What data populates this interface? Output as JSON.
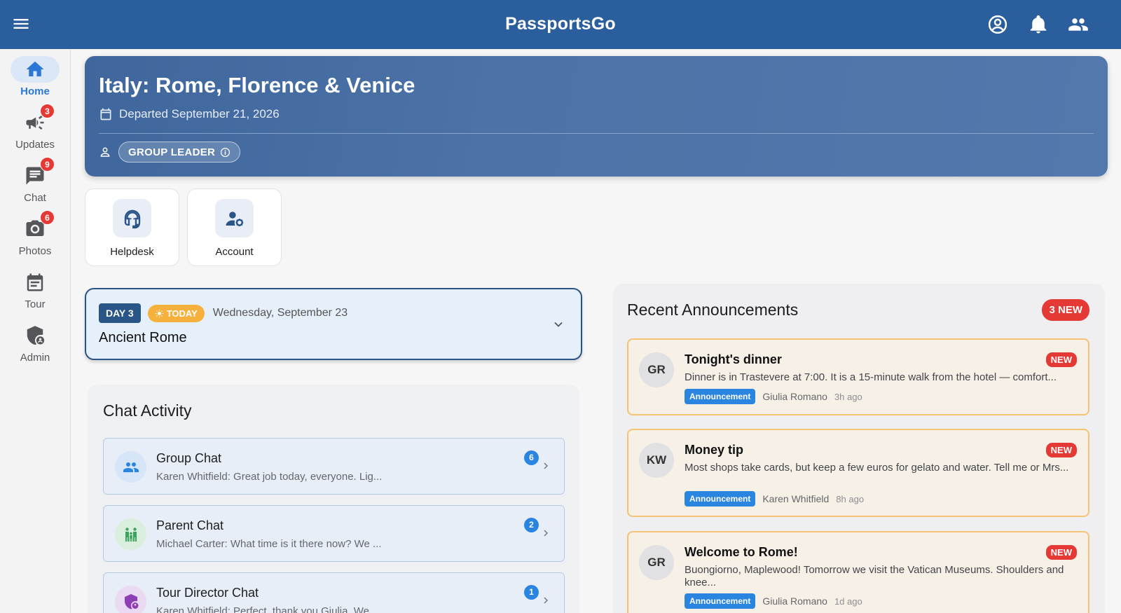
{
  "app": {
    "title": "PassportsGo"
  },
  "sidebar": {
    "items": [
      {
        "label": "Home",
        "badge": ""
      },
      {
        "label": "Updates",
        "badge": "3"
      },
      {
        "label": "Chat",
        "badge": "9"
      },
      {
        "label": "Photos",
        "badge": "6"
      },
      {
        "label": "Tour",
        "badge": ""
      },
      {
        "label": "Admin",
        "badge": ""
      }
    ]
  },
  "trip": {
    "title": "Italy: Rome, Florence & Venice",
    "departed": "Departed September 21, 2026",
    "role": "GROUP LEADER"
  },
  "quick_actions": [
    {
      "label": "Helpdesk"
    },
    {
      "label": "Account"
    }
  ],
  "day": {
    "number": "DAY 3",
    "today": "TODAY",
    "date": "Wednesday, September 23",
    "title": "Ancient Rome"
  },
  "chat_activity": {
    "title": "Chat Activity",
    "items": [
      {
        "name": "Group Chat",
        "preview": "Karen Whitfield: Great job today, everyone. Lig...",
        "count": "6"
      },
      {
        "name": "Parent Chat",
        "preview": "Michael Carter: What time is it there now? We ...",
        "count": "2"
      },
      {
        "name": "Tour Director Chat",
        "preview": "Karen Whitfield: Perfect, thank you Giulia. We ...",
        "count": "1"
      }
    ]
  },
  "announcements": {
    "title": "Recent Announcements",
    "new_count": "3 NEW",
    "items": [
      {
        "initials": "GR",
        "title": "Tonight's dinner",
        "body": "Dinner is in Trastevere at 7:00. It is a 15-minute walk from the hotel — comfort...",
        "tag": "Announcement",
        "author": "Giulia Romano",
        "ago": "3h ago",
        "new": "NEW"
      },
      {
        "initials": "KW",
        "title": "Money tip",
        "body": "Most shops take cards, but keep a few euros for gelato and water. Tell me or Mrs...",
        "tag": "Announcement",
        "author": "Karen Whitfield",
        "ago": "8h ago",
        "new": "NEW"
      },
      {
        "initials": "GR",
        "title": "Welcome to Rome!",
        "body": "Buongiorno, Maplewood! Tomorrow we visit the Vatican Museums. Shoulders and knee...",
        "tag": "Announcement",
        "author": "Giulia Romano",
        "ago": "1d ago",
        "new": "NEW"
      }
    ]
  },
  "colors": {
    "brand": "#2a5e9c",
    "accent": "#2a85e0",
    "alert": "#e53935",
    "today": "#f6b03c"
  }
}
